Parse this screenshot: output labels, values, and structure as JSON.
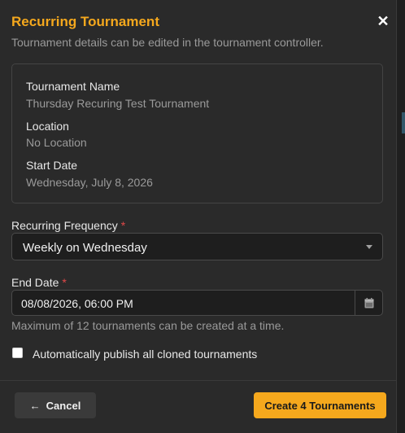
{
  "modal": {
    "title": "Recurring Tournament",
    "subtitle": "Tournament details can be edited in the tournament controller.",
    "close_icon": "close-icon"
  },
  "details": {
    "name_label": "Tournament Name",
    "name_value": "Thursday Recuring Test Tournament",
    "location_label": "Location",
    "location_value": "No Location",
    "start_label": "Start Date",
    "start_value": "Wednesday, July 8, 2026"
  },
  "form": {
    "frequency_label": "Recurring Frequency",
    "frequency_value": "Weekly on Wednesday",
    "end_date_label": "End Date",
    "end_date_value": "08/08/2026, 06:00 PM",
    "required_mark": "*",
    "help_text": "Maximum of 12 tournaments can be created at a time.",
    "publish_label": "Automatically publish all cloned tournaments",
    "publish_checked": false
  },
  "footer": {
    "cancel_label": "Cancel",
    "create_label": "Create 4 Tournaments"
  },
  "colors": {
    "accent": "#f5a81d",
    "required": "#e04848",
    "background": "#2a2a2a"
  }
}
